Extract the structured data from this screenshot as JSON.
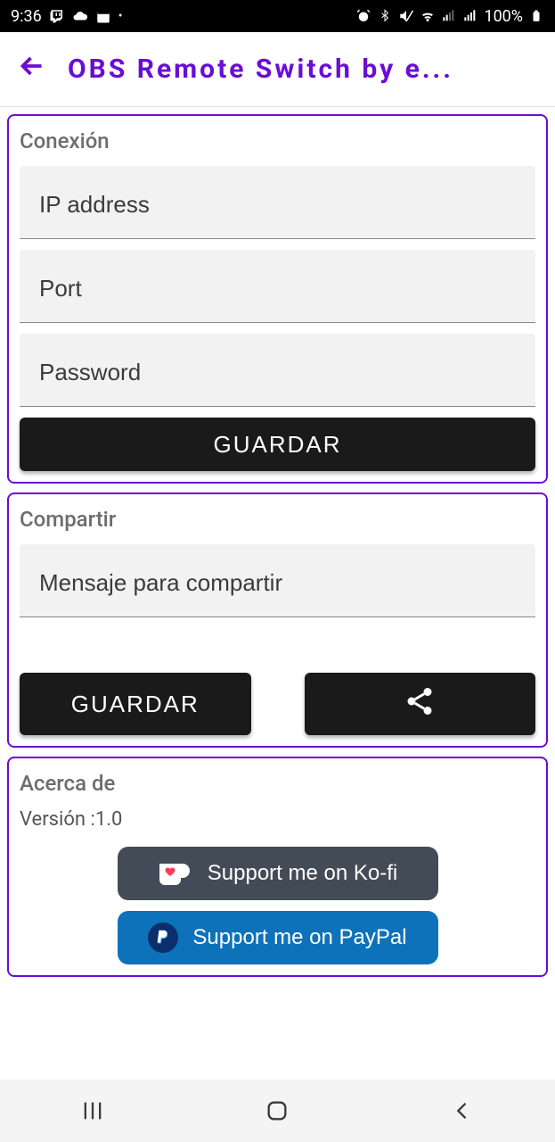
{
  "status": {
    "time": "9:36",
    "battery": "100%"
  },
  "header": {
    "title": "OBS Remote Switch by e..."
  },
  "connection": {
    "title": "Conexión",
    "ip_placeholder": "IP address",
    "port_placeholder": "Port",
    "password_placeholder": "Password",
    "save_label": "GUARDAR"
  },
  "share": {
    "title": "Compartir",
    "message_placeholder": "Mensaje para compartir",
    "save_label": "GUARDAR"
  },
  "about": {
    "title": "Acerca de",
    "version_text": "Versión :1.0",
    "kofi_label": "Support me on Ko-fi",
    "paypal_label": "Support me on PayPal"
  }
}
